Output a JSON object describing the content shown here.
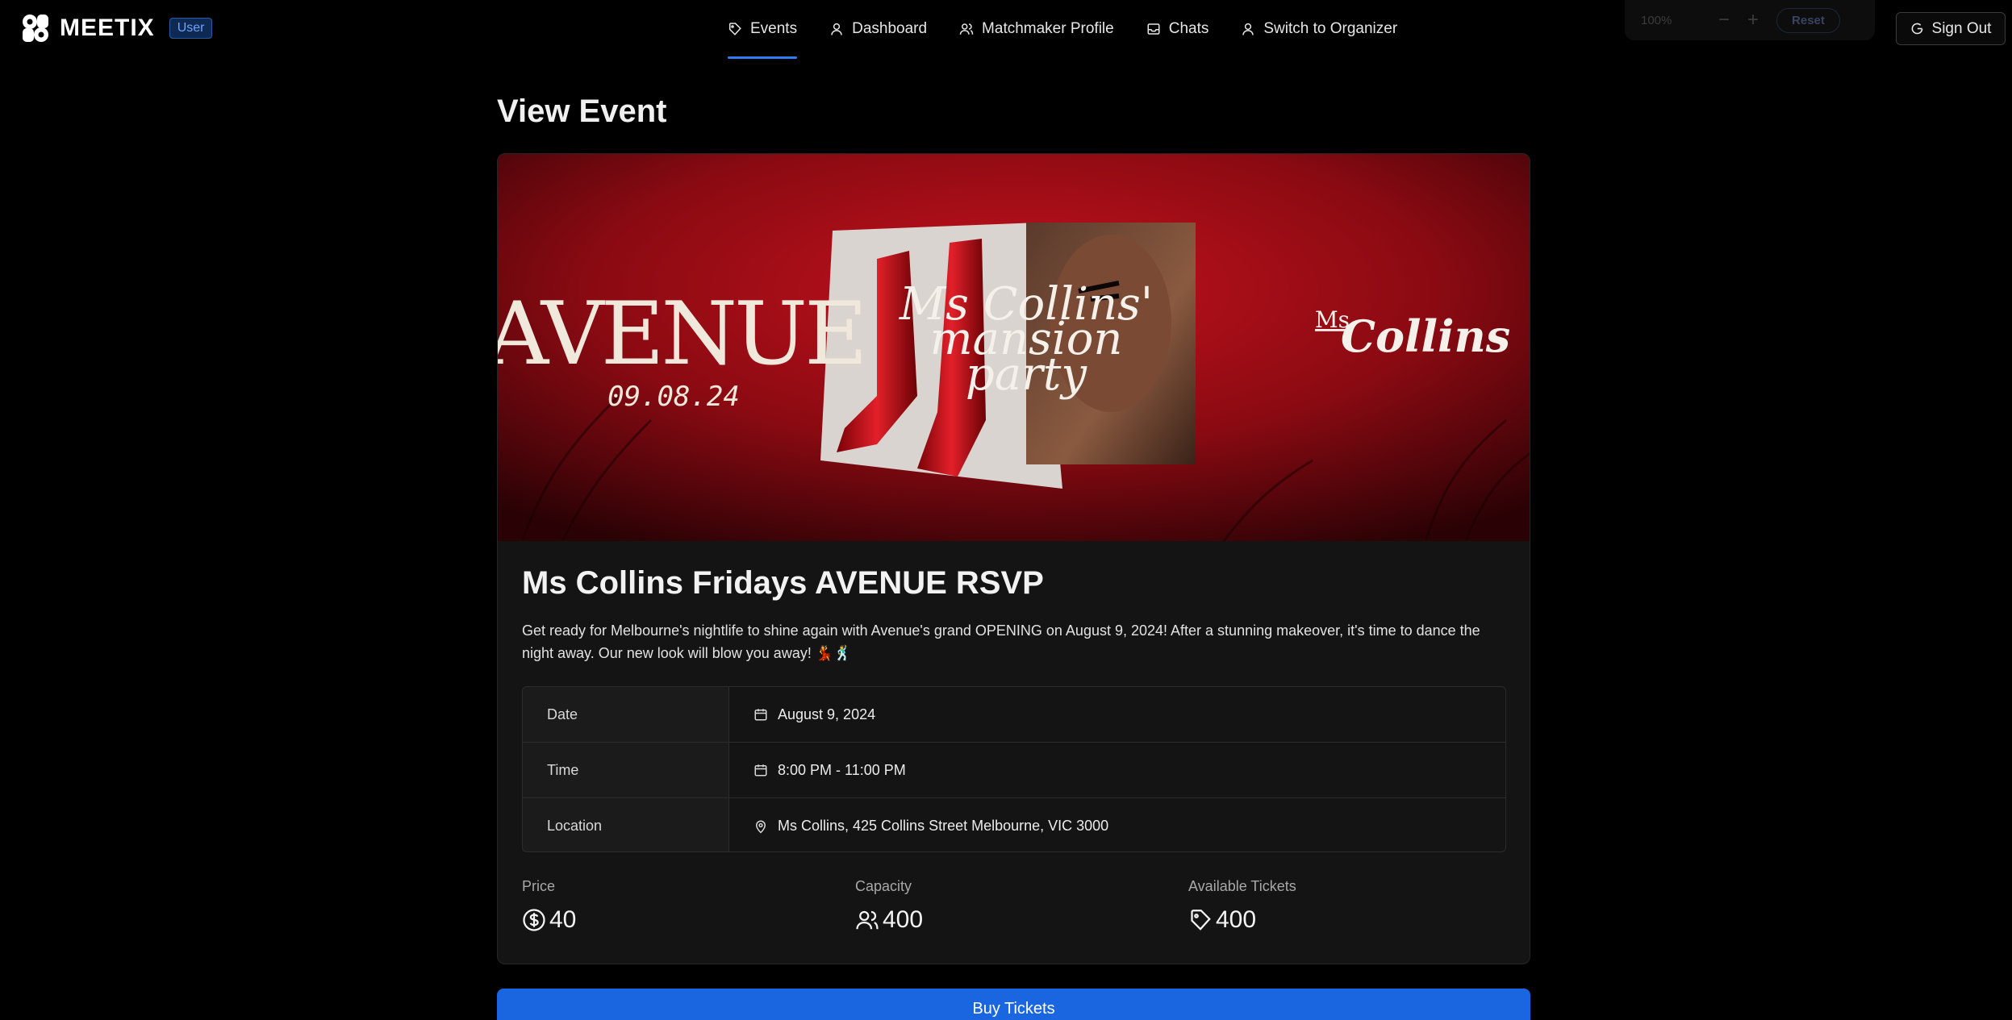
{
  "brand": {
    "name": "MEETIX",
    "role_badge": "User"
  },
  "nav": {
    "items": [
      {
        "label": "Events",
        "icon": "tag-icon",
        "active": true
      },
      {
        "label": "Dashboard",
        "icon": "user-icon"
      },
      {
        "label": "Matchmaker Profile",
        "icon": "users-icon"
      },
      {
        "label": "Chats",
        "icon": "inbox-icon"
      },
      {
        "label": "Switch to Organizer",
        "icon": "user-icon"
      }
    ]
  },
  "zoom": {
    "level": "100%",
    "minus": "−",
    "plus": "+",
    "reset_label": "Reset"
  },
  "auth": {
    "sign_out_label": "Sign Out"
  },
  "page": {
    "title": "View Event"
  },
  "banner": {
    "venue": "AVENUE",
    "date": "09.08.24",
    "headline_line1": "Ms Collins'",
    "headline_line2": "mansion",
    "headline_line3": "party",
    "brand_small": "Ms",
    "brand_script": "Collins"
  },
  "event": {
    "title": "Ms Collins Fridays AVENUE RSVP",
    "description": "Get ready for Melbourne's nightlife to shine again with Avenue's grand OPENING on August 9, 2024! After a stunning makeover, it's time to dance the night away. Our new look will blow you away! 💃🕺",
    "details": {
      "date_label": "Date",
      "date_value": "August 9, 2024",
      "time_label": "Time",
      "time_value": "8:00 PM - 11:00 PM",
      "location_label": "Location",
      "location_value": "Ms Collins, 425 Collins Street Melbourne, VIC 3000"
    },
    "stats": {
      "price_label": "Price",
      "price_value": "40",
      "capacity_label": "Capacity",
      "capacity_value": "400",
      "available_label": "Available Tickets",
      "available_value": "400"
    }
  },
  "actions": {
    "buy_label": "Buy Tickets"
  },
  "colors": {
    "accent": "#1a66e0",
    "background": "#000000",
    "card": "#141414",
    "banner_red": "#b3101a"
  }
}
